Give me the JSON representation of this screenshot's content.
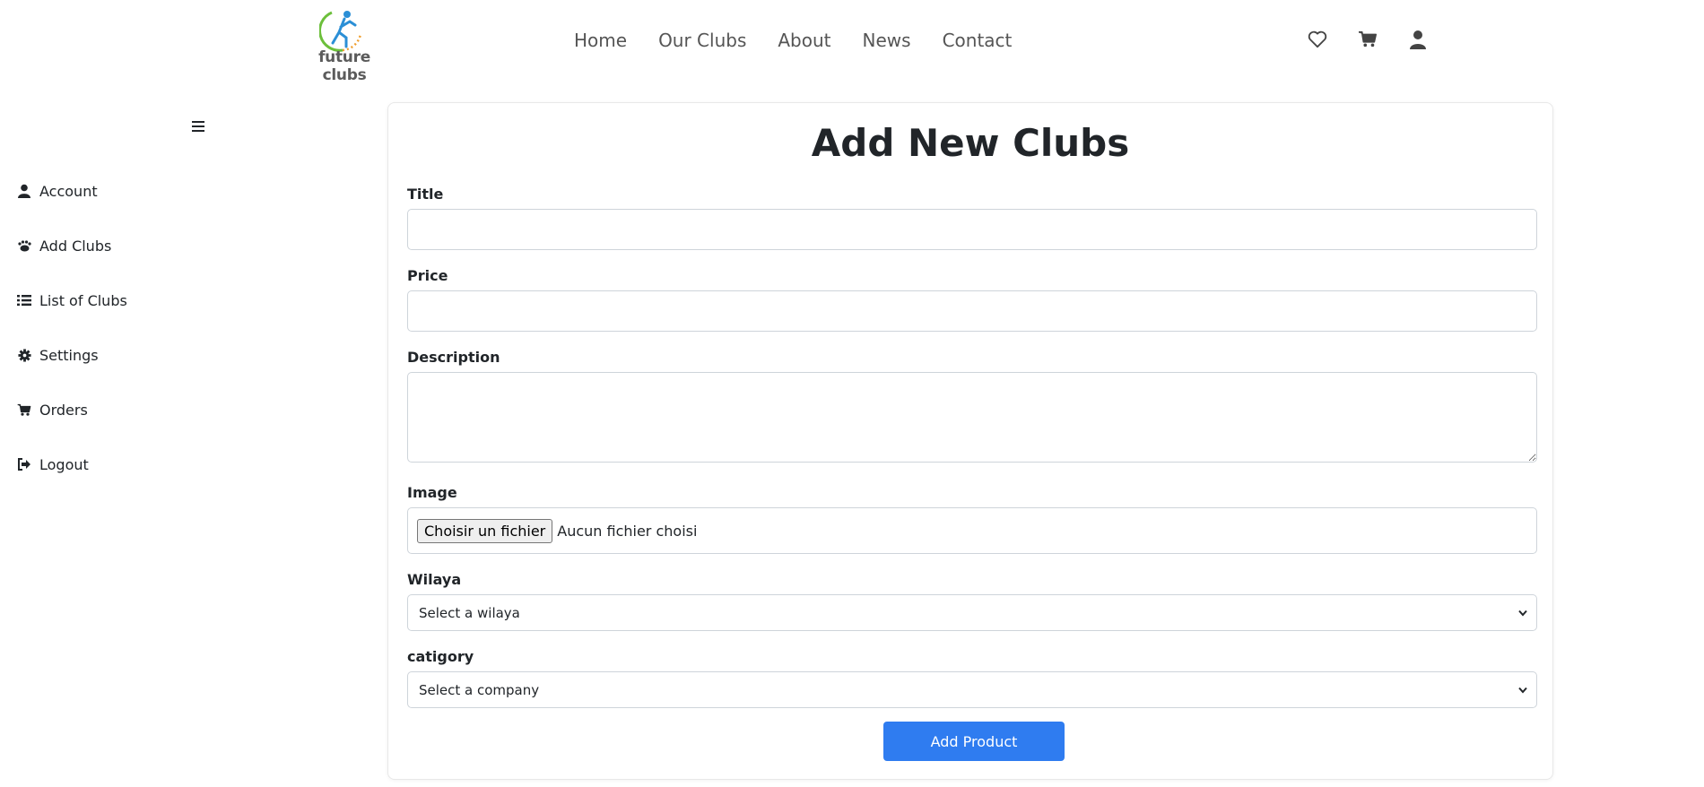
{
  "brand": {
    "name": "future clubs"
  },
  "nav": {
    "items": [
      "Home",
      "Our Clubs",
      "About",
      "News",
      "Contact"
    ]
  },
  "header_icons": [
    "heart-icon",
    "cart-icon",
    "user-icon"
  ],
  "sidebar": {
    "items": [
      {
        "label": "Account",
        "icon": "user-icon"
      },
      {
        "label": "Add Clubs",
        "icon": "paw-icon"
      },
      {
        "label": "List of Clubs",
        "icon": "list-icon"
      },
      {
        "label": "Settings",
        "icon": "gear-icon"
      },
      {
        "label": "Orders",
        "icon": "cart-icon"
      },
      {
        "label": "Logout",
        "icon": "logout-icon"
      }
    ]
  },
  "form": {
    "title": "Add New Clubs",
    "title_label": "Title",
    "title_value": "",
    "price_label": "Price",
    "price_value": "",
    "description_label": "Description",
    "description_value": "",
    "image_label": "Image",
    "file_button": "Choisir un fichier",
    "file_status": "Aucun fichier choisi",
    "wilaya_label": "Wilaya",
    "wilaya_selected": "Select a wilaya",
    "category_label": "catigory",
    "category_selected": "Select a company",
    "submit_label": "Add Product"
  },
  "colors": {
    "primary_button": "#2f7cf0",
    "nav_text": "#555555",
    "logo_green": "#6cbf3b",
    "logo_blue": "#2b8fd6",
    "logo_orange": "#f0a030"
  }
}
